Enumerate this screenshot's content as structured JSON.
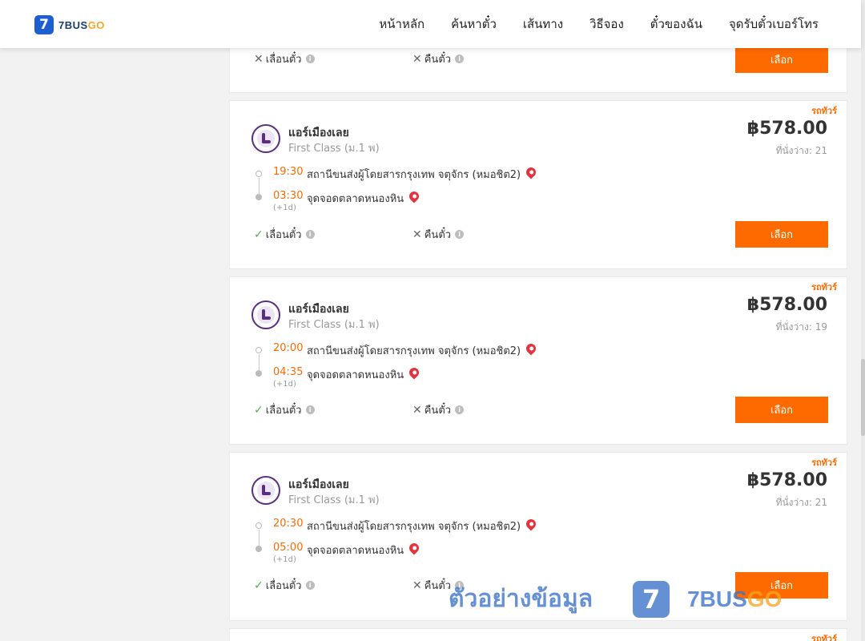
{
  "logo": {
    "badge": "7",
    "text_a": "7BUS",
    "text_b": "GO"
  },
  "nav": [
    "หน้าหลัก",
    "ค้นหาตั๋ว",
    "เส้นทาง",
    "วิธีจอง",
    "ตั๋วของฉัน",
    "จุดรับตั๋วเบอร์โทร"
  ],
  "top_card": {
    "change_label": "เลื่อนตั๋ว",
    "refund_label": "คืนตั๋ว",
    "select_label": "เลือก"
  },
  "cards": [
    {
      "tag": "รถทัวร์",
      "operator": "แอร์เมืองเลย",
      "bus_class": "First Class (ม.1 พ)",
      "price": "฿578.00",
      "seats": "ที่นั่งว่าง: 21",
      "depart_time": "19:30",
      "depart_place": "สถานีขนส่งผู้โดยสารกรุงเทพ จตุจักร (หมอชิต2)",
      "arrive_time": "03:30",
      "arrive_place": "จุดจอดตลาดหนองหิน",
      "next_day": "(+1d)",
      "change_label": "เลื่อนตั๋ว",
      "refund_label": "คืนตั๋ว",
      "select_label": "เลือก"
    },
    {
      "tag": "รถทัวร์",
      "operator": "แอร์เมืองเลย",
      "bus_class": "First Class (ม.1 พ)",
      "price": "฿578.00",
      "seats": "ที่นั่งว่าง: 19",
      "depart_time": "20:00",
      "depart_place": "สถานีขนส่งผู้โดยสารกรุงเทพ จตุจักร (หมอชิต2)",
      "arrive_time": "04:35",
      "arrive_place": "จุดจอดตลาดหนองหิน",
      "next_day": "(+1d)",
      "change_label": "เลื่อนตั๋ว",
      "refund_label": "คืนตั๋ว",
      "select_label": "เลือก"
    },
    {
      "tag": "รถทัวร์",
      "operator": "แอร์เมืองเลย",
      "bus_class": "First Class (ม.1 พ)",
      "price": "฿578.00",
      "seats": "ที่นั่งว่าง: 21",
      "depart_time": "20:30",
      "depart_place": "สถานีขนส่งผู้โดยสารกรุงเทพ จตุจักร (หมอชิต2)",
      "arrive_time": "05:00",
      "arrive_place": "จุดจอดตลาดหนองหิน",
      "next_day": "(+1d)",
      "change_label": "เลื่อนตั๋ว",
      "refund_label": "คืนตั๋ว",
      "select_label": "เลือก"
    }
  ],
  "bottom_card": {
    "tag": "รถทัวร์"
  },
  "watermark": {
    "text": "ตัวอย่างข้อมูล",
    "badge": "7",
    "brand_a": "7BUS",
    "brand_b": "GO"
  },
  "colors": {
    "accent": "#ff6a00",
    "brand_blue": "#1c5fd1",
    "brand_orange": "#f5a623",
    "pin_red": "#e5333d"
  }
}
